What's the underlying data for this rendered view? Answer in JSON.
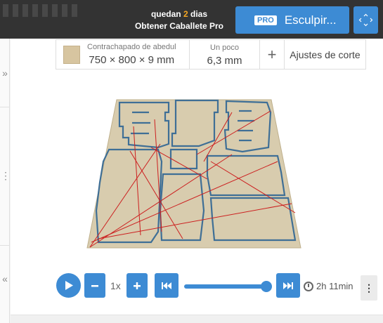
{
  "header": {
    "trial_prefix": "quedan",
    "trial_days": "2",
    "trial_suffix": "dias",
    "upgrade_link": "Obtener Caballete Pro",
    "pro_badge": "PRO",
    "sculpt_label": "Esculpir...",
    "nav_icon": "move-arrows-icon"
  },
  "settings": {
    "material_name": "Contrachapado de abedul",
    "material_size": "750 × 800 × 9 mm",
    "bit_label": "Un poco",
    "bit_size": "6,3 mm",
    "add_icon": "+",
    "cut_settings": "Ajustes de corte"
  },
  "sidebar": {
    "expand_top": "»",
    "handle": "⋮",
    "collapse_bottom": "«"
  },
  "playback": {
    "speed": "1x",
    "duration": "2h 11min",
    "progress": 1.0,
    "more_icon": "⋮"
  },
  "colors": {
    "accent": "#3d8bd4",
    "topbar": "#333333",
    "days_highlight": "#f5a623",
    "board": "#d8ccae",
    "toolpath": "#cc1f1f"
  }
}
